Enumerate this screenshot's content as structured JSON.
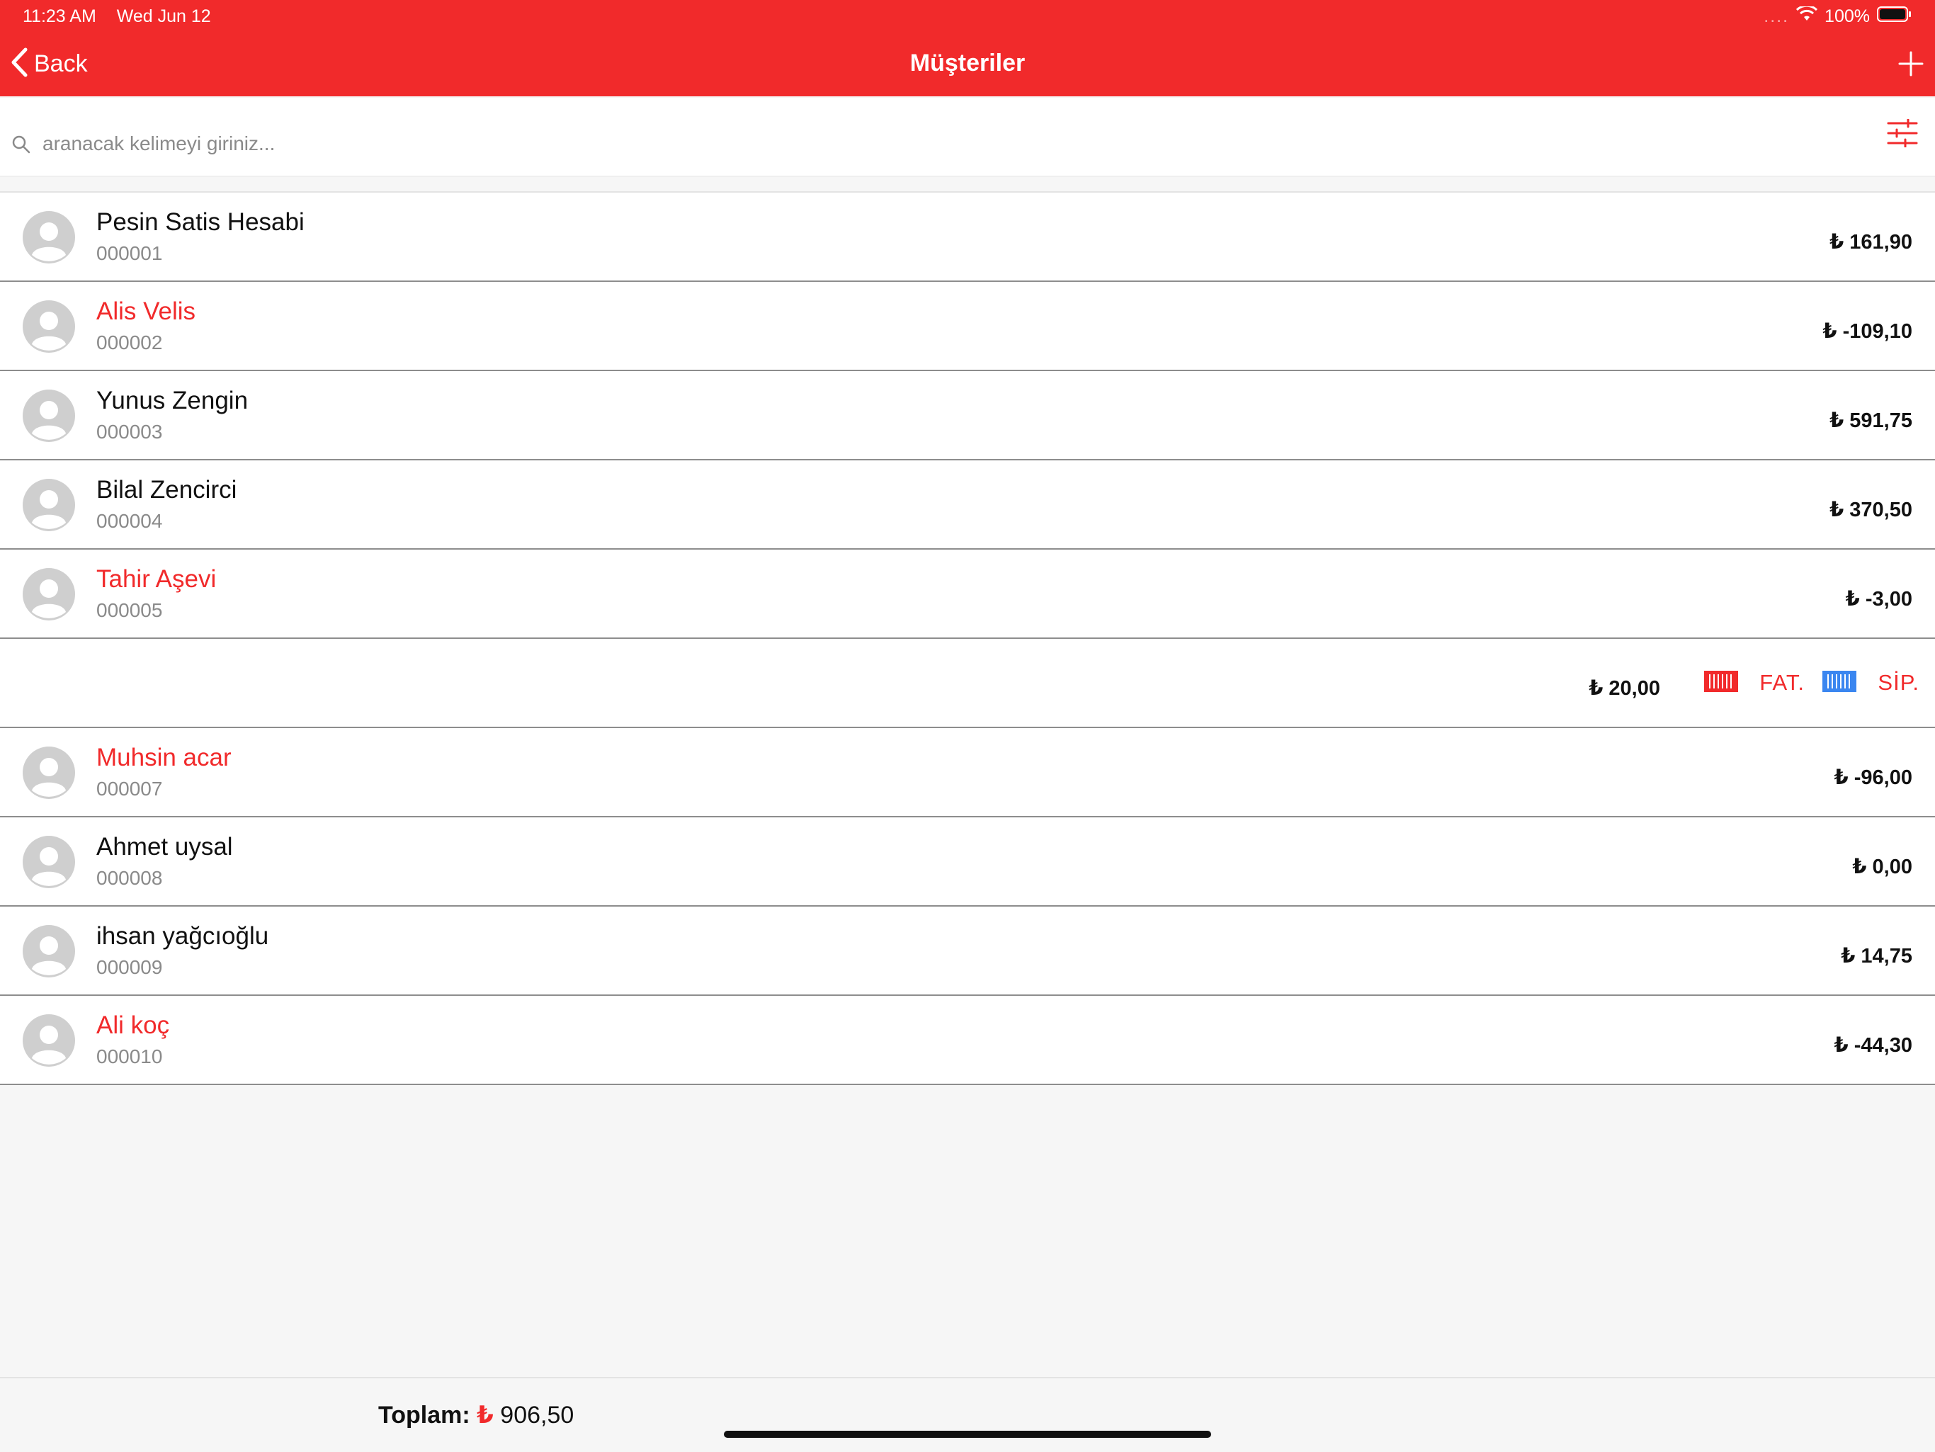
{
  "status_bar": {
    "time": "11:23 AM",
    "date": "Wed Jun 12",
    "signal": "....",
    "battery_percent": "100%"
  },
  "nav": {
    "back_label": "Back",
    "title": "Müşteriler",
    "add_icon": "plus-icon"
  },
  "search": {
    "placeholder": "aranacak kelimeyi giriniz...",
    "value": "",
    "filter_icon": "sliders-icon"
  },
  "colors": {
    "accent": "#f12a2b",
    "negative_name": "#f12a2b",
    "order_icon": "#3a86f0"
  },
  "customers": [
    {
      "name": "Pesin Satis Hesabi",
      "code": "000001",
      "amount": "₺ 161,90",
      "highlight": false
    },
    {
      "name": "Alis Velis",
      "code": "000002",
      "amount": "₺ -109,10",
      "highlight": true
    },
    {
      "name": "Yunus Zengin",
      "code": "000003",
      "amount": "₺ 591,75",
      "highlight": false
    },
    {
      "name": "Bilal Zencirci",
      "code": "000004",
      "amount": "₺ 370,50",
      "highlight": false
    },
    {
      "name": "Tahir Aşevi",
      "code": "000005",
      "amount": "₺ -3,00",
      "highlight": true
    }
  ],
  "swiped_row": {
    "amount": "₺ 20,00",
    "invoice_label": "FAT.",
    "order_label": "SİP."
  },
  "customers_after": [
    {
      "name": "Muhsin acar",
      "code": "000007",
      "amount": "₺ -96,00",
      "highlight": true
    },
    {
      "name": "Ahmet uysal",
      "code": "000008",
      "amount": "₺ 0,00",
      "highlight": false
    },
    {
      "name": "ihsan yağcıoğlu",
      "code": "000009",
      "amount": "₺ 14,75",
      "highlight": false
    },
    {
      "name": "Ali koç",
      "code": "000010",
      "amount": "₺ -44,30",
      "highlight": true
    }
  ],
  "footer": {
    "total_label": "Toplam:",
    "currency": "₺",
    "total_value": "906,50"
  }
}
